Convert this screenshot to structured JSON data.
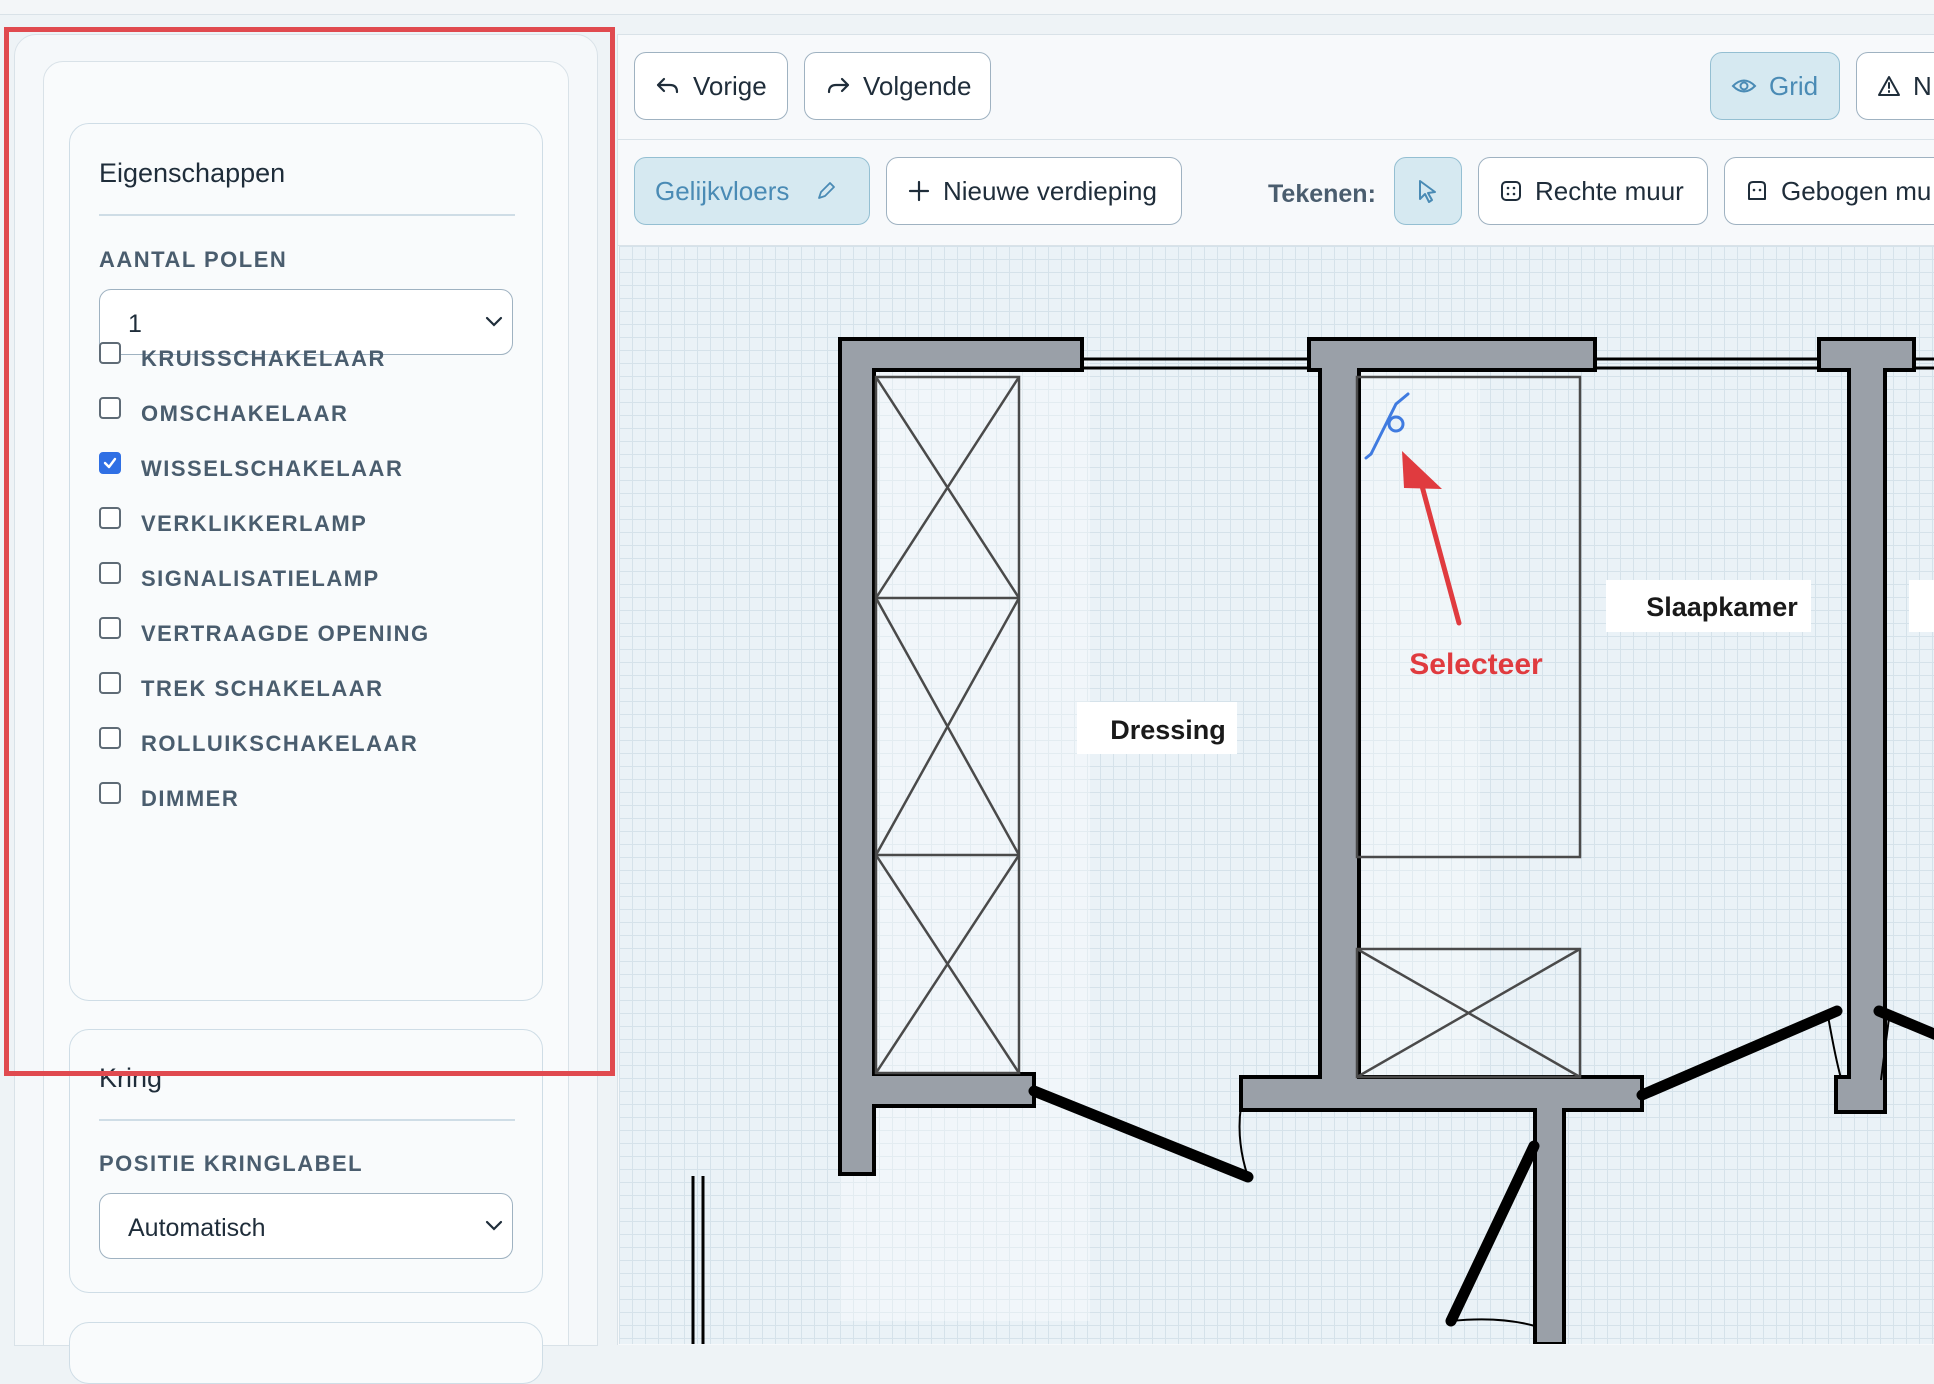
{
  "toolbar": {
    "back_label": "Vorige",
    "forward_label": "Volgende",
    "grid_label": "Grid",
    "warnings_label": "N",
    "floor_label": "Gelijkvloers",
    "new_floor_label": "Nieuwe verdieping",
    "draw_label": "Tekenen:",
    "straight_wall_label": "Rechte muur",
    "curved_wall_label": "Gebogen mu"
  },
  "properties": {
    "title": "Eigenschappen",
    "poles_label": "AANTAL POLEN",
    "poles_value": "1",
    "options": [
      {
        "label": "KRUISSCHAKELAAR",
        "checked": false
      },
      {
        "label": "OMSCHAKELAAR",
        "checked": false
      },
      {
        "label": "WISSELSCHAKELAAR",
        "checked": true
      },
      {
        "label": "VERKLIKKERLAMP",
        "checked": false
      },
      {
        "label": "SIGNALISATIELAMP",
        "checked": false
      },
      {
        "label": "VERTRAAGDE OPENING",
        "checked": false
      },
      {
        "label": "TREK SCHAKELAAR",
        "checked": false
      },
      {
        "label": "ROLLUIKSCHAKELAAR",
        "checked": false
      },
      {
        "label": "DIMMER",
        "checked": false
      }
    ]
  },
  "kring": {
    "title": "Kring",
    "position_label": "POSITIE KRINGLABEL",
    "position_value": "Automatisch"
  },
  "plan": {
    "rooms": [
      "Dressing",
      "Slaapkamer"
    ],
    "annotation": "Selecteer"
  },
  "colors": {
    "accent": "#2f6fe4",
    "highlight": "#e04a4f",
    "wall": "#9aa0a8",
    "symbol": "#3f7be0"
  }
}
